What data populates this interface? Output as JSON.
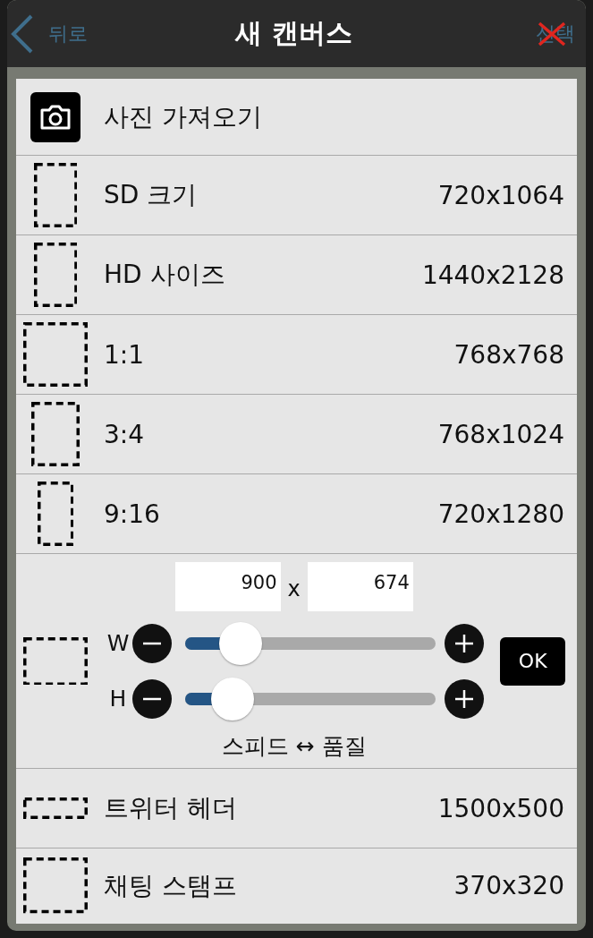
{
  "header": {
    "back_label": "뒤로",
    "title": "새 캔버스",
    "select_label": "선택",
    "select_crossed_out": true
  },
  "items": [
    {
      "kind": "import",
      "label": "사진 가져오기"
    },
    {
      "kind": "preset",
      "label": "SD 크기",
      "size": "720x1064"
    },
    {
      "kind": "preset",
      "label": "HD 사이즈",
      "size": "1440x2128"
    },
    {
      "kind": "preset",
      "label": "1:1",
      "size": "768x768"
    },
    {
      "kind": "preset",
      "label": "3:4",
      "size": "768x1024"
    },
    {
      "kind": "preset",
      "label": "9:16",
      "size": "720x1280"
    },
    {
      "kind": "custom",
      "width_value": "900",
      "separator": "x",
      "height_value": "674",
      "sliders": [
        {
          "label": "W",
          "level": 0.22
        },
        {
          "label": "H",
          "level": 0.19
        }
      ],
      "ok_label": "OK",
      "caption": "스피드 ↔ 품질"
    },
    {
      "kind": "preset",
      "label": "트위터 헤더",
      "size": "1500x500"
    },
    {
      "kind": "preset",
      "label": "채팅 스탬프",
      "size": "370x320"
    }
  ]
}
